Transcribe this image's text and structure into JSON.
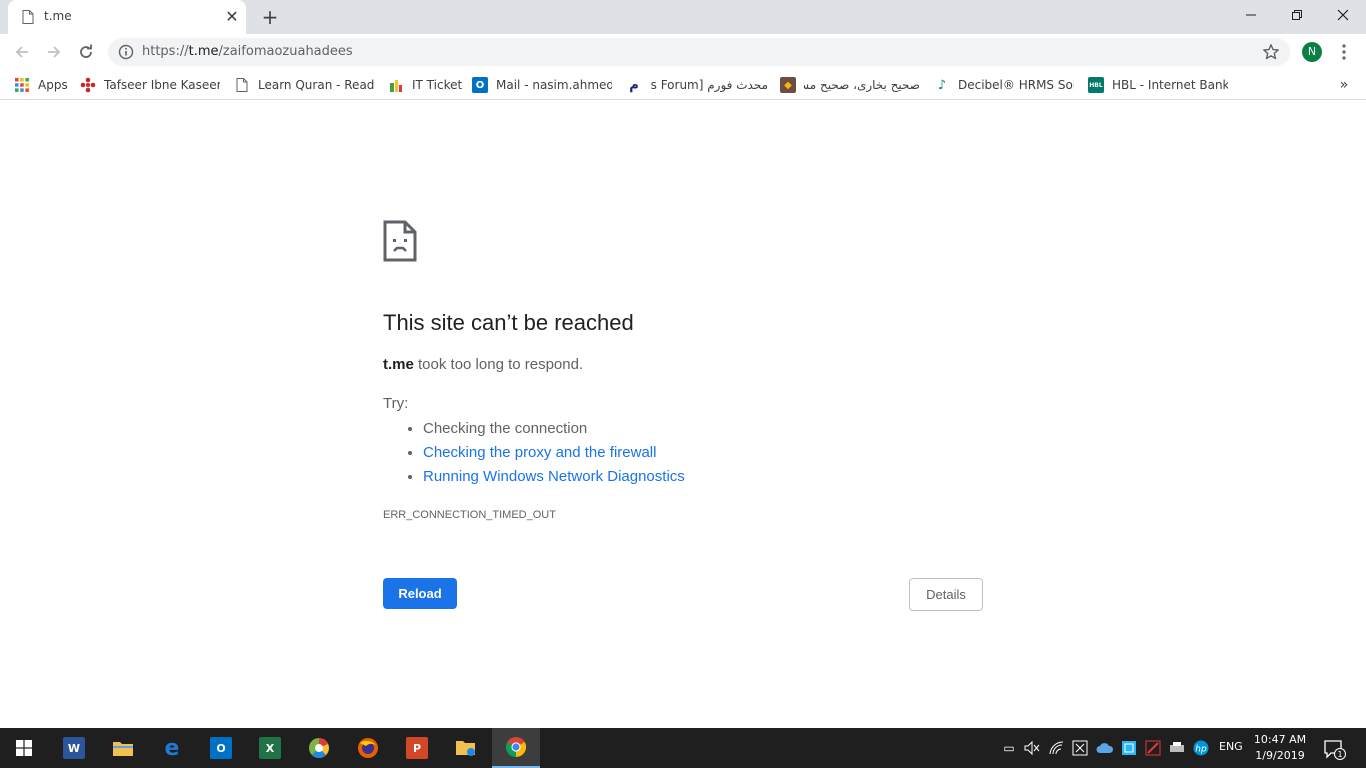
{
  "tab": {
    "title": "t.me",
    "close": "✕",
    "new_tab": "+"
  },
  "toolbar": {
    "url_prefix": "https://",
    "url_host": "t.me",
    "url_path": "/zaifomaozuahadees",
    "avatar_letter": "N"
  },
  "bookmarks": {
    "items": [
      {
        "label": "Apps"
      },
      {
        "label": "Tafseer Ibne Kaseer U"
      },
      {
        "label": "Learn Quran - Read C"
      },
      {
        "label": "IT Ticket"
      },
      {
        "label": "Mail - nasim.ahmed@"
      },
      {
        "label": "محدث فورم [Mohaddis Forum]"
      },
      {
        "label": "صحيح بخاری، صحیح مسلم"
      },
      {
        "label": "Decibel® HRMS Solu"
      },
      {
        "label": "HBL - Internet Bankin"
      }
    ],
    "more": "»"
  },
  "error": {
    "title": "This site can’t be reached",
    "host": "t.me",
    "desc_rest": " took too long to respond.",
    "try_label": "Try:",
    "suggestions": [
      "Checking the connection",
      "Checking the proxy and the firewall",
      "Running Windows Network Diagnostics"
    ],
    "code": "ERR_CONNECTION_TIMED_OUT",
    "reload_label": "Reload",
    "details_label": "Details"
  },
  "taskbar": {
    "apps": [
      {
        "name": "word",
        "letter": "W",
        "color": "#2b579a"
      },
      {
        "name": "file-explorer",
        "letter": "",
        "color": "#f0c050"
      },
      {
        "name": "edge",
        "letter": "e",
        "color": "#1e7ad6"
      },
      {
        "name": "outlook",
        "letter": "O",
        "color": "#0072c6"
      },
      {
        "name": "excel",
        "letter": "X",
        "color": "#217346"
      },
      {
        "name": "picasa",
        "letter": "",
        "color": "#7cb342"
      },
      {
        "name": "firefox",
        "letter": "",
        "color": "#e66000"
      },
      {
        "name": "powerpoint",
        "letter": "P",
        "color": "#d24726"
      },
      {
        "name": "sharing-folder",
        "letter": "",
        "color": "#f0c050"
      },
      {
        "name": "chrome",
        "letter": "",
        "color": "#4285f4"
      }
    ],
    "lang": "ENG",
    "time": "10:47 AM",
    "date": "1/9/2019",
    "notif_count": "1"
  },
  "colors": {
    "accent": "#1a73e8",
    "tabstrip": "#dee1e6",
    "taskbar": "#1f1f1f"
  }
}
